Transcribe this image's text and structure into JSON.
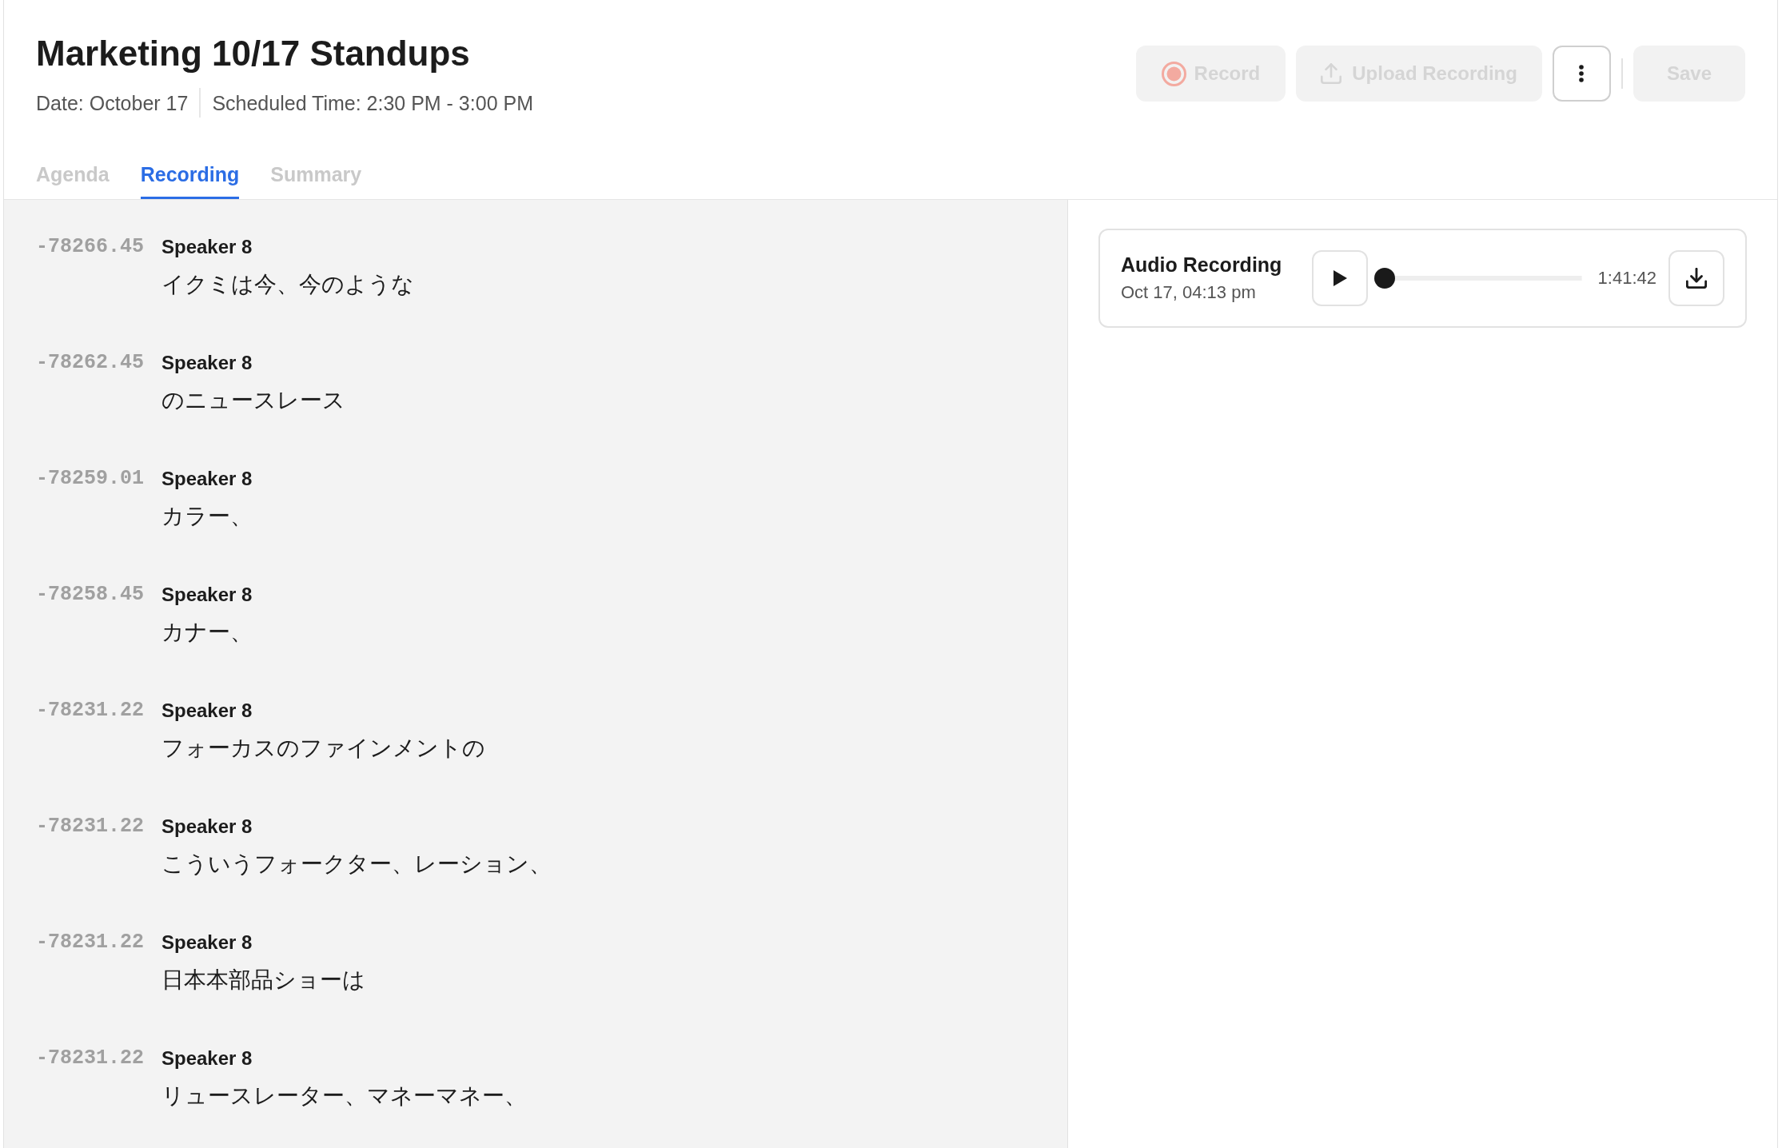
{
  "header": {
    "title": "Marketing 10/17 Standups",
    "meta": [
      "Date: October 17",
      "Scheduled Time: 2:30 PM - 3:00 PM"
    ]
  },
  "actions": [
    {
      "kind": "record",
      "label": "Record",
      "disabled": true
    },
    {
      "kind": "upload",
      "label": "Upload Recording",
      "disabled": true
    },
    {
      "kind": "more",
      "disabled": false
    },
    {
      "kind": "save",
      "label": "Save",
      "disabled": true
    }
  ],
  "tabs": [
    {
      "label": "Agenda",
      "selected": false
    },
    {
      "label": "Recording",
      "selected": true
    },
    {
      "label": "Summary",
      "selected": false
    }
  ],
  "transcript": [
    {
      "time": "-78266.45",
      "speaker": "Speaker 8",
      "text": "イクミは今、今のような"
    },
    {
      "time": "-78262.45",
      "speaker": "Speaker 8",
      "text": "のニュースレース"
    },
    {
      "time": "-78259.01",
      "speaker": "Speaker 8",
      "text": "カラー、"
    },
    {
      "time": "-78258.45",
      "speaker": "Speaker 8",
      "text": "カナー、"
    },
    {
      "time": "-78231.22",
      "speaker": "Speaker 8",
      "text": "フォーカスのファインメントの"
    },
    {
      "time": "-78231.22",
      "speaker": "Speaker 8",
      "text": "こういうフォークター、レーション、"
    },
    {
      "time": "-78231.22",
      "speaker": "Speaker 8",
      "text": "日本本部品ショーは"
    },
    {
      "time": "-78231.22",
      "speaker": "Speaker 8",
      "text": "リュースレーター、マネーマネー、"
    }
  ],
  "audio": {
    "title": "Audio Recording",
    "date": "Oct 17, 04:13 pm",
    "level": 0,
    "duration": "1:41:42"
  }
}
